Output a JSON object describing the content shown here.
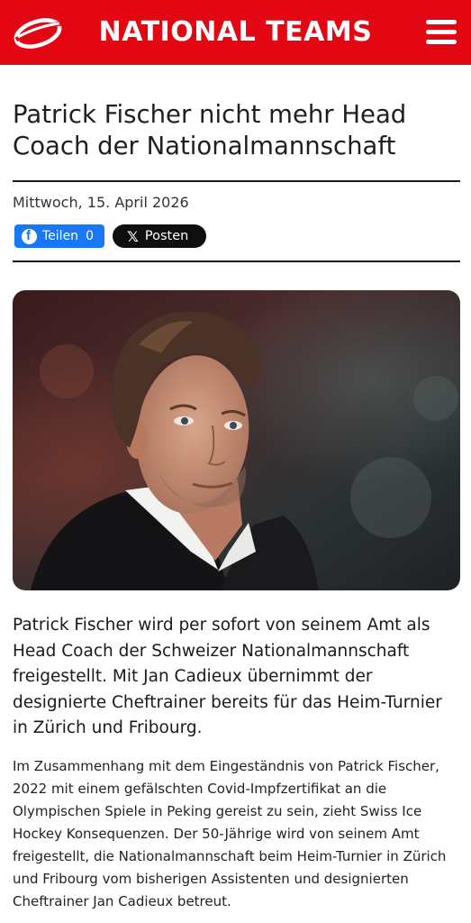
{
  "header": {
    "brand": "NATIONAL TEAMS",
    "logo_icon": "swoosh-logo-icon",
    "menu_icon": "hamburger-menu-icon",
    "bg_color": "#e30613"
  },
  "article": {
    "title": "Patrick Fischer nicht mehr Head Coach der Nationalmannschaft",
    "date": "Mittwoch, 15. April 2026",
    "share": {
      "facebook_label": "Teilen",
      "facebook_count": "0",
      "x_label": "Posten"
    },
    "lead": "Patrick Fischer wird per sofort von seinem Amt als Head Coach der Schweizer Nationalmannschaft freigestellt. Mit Jan Cadieux übernimmt der designierte Cheftrainer bereits für das Heim-Turnier in Zürich und Fribourg.",
    "body": "Im Zusammenhang mit dem Eingeständnis von Patrick Fischer, 2022 mit einem gefälschten Covid-Impfzertifikat an die Olympischen Spiele in Peking gereist zu sein, zieht Swiss Ice Hockey Konsequenzen. Der 50-Jährige wird von seinem Amt freigestellt, die Nationalmannschaft beim Heim-Turnier in Zürich und Fribourg vom bisherigen Assistenten und designierten Cheftrainer Jan Cadieux betreut."
  }
}
